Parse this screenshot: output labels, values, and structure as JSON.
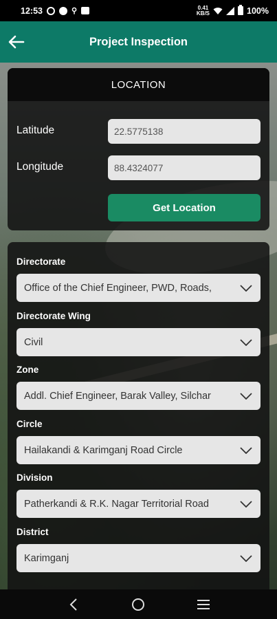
{
  "status": {
    "time": "12:53",
    "net_small": "0.41\nKB/S",
    "battery": "100%"
  },
  "app_bar": {
    "title": "Project Inspection"
  },
  "location": {
    "header": "LOCATION",
    "latitude_label": "Latitude",
    "latitude_value": "22.5775138",
    "longitude_label": "Longitude",
    "longitude_value": "88.4324077",
    "get_location_label": "Get Location"
  },
  "form": {
    "fields": [
      {
        "label": "Directorate",
        "value": "Office of the Chief Engineer, PWD, Roads,"
      },
      {
        "label": "Directorate Wing",
        "value": "Civil"
      },
      {
        "label": "Zone",
        "value": "Addl. Chief Engineer, Barak Valley, Silchar"
      },
      {
        "label": "Circle",
        "value": "Hailakandi & Karimganj Road Circle"
      },
      {
        "label": "Division",
        "value": "Patherkandi & R.K. Nagar Territorial Road"
      },
      {
        "label": "District",
        "value": "Karimganj"
      }
    ]
  },
  "colors": {
    "app_bar": "#0d7a67",
    "button": "#1a8b63"
  },
  "icons": {
    "back": "arrow-left-icon",
    "dropdown": "chevron-down-icon",
    "nav_back": "nav-back-icon",
    "nav_home": "nav-home-icon",
    "nav_menu": "nav-menu-icon"
  }
}
